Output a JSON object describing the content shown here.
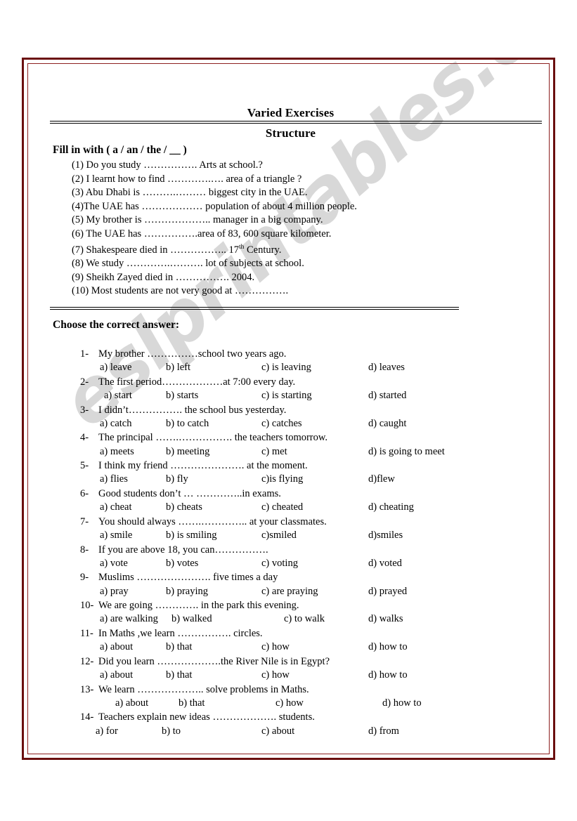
{
  "document": {
    "title": "Varied Exercises",
    "subtitle": "Structure"
  },
  "watermark": {
    "text": "eslprintables.com",
    "color": "#5a5a5a"
  },
  "frame": {
    "outer_color": "#6b0f0f",
    "inner_color": "#8d2020"
  },
  "section_fill": {
    "heading": "Fill in with (  a  /  an  / the /  __  )",
    "items": [
      "(1) Do you study ……………. Arts at school.?",
      "(2) I learnt how to find ………….…. area of a triangle ?",
      "(3) Abu Dhabi is ……….……… biggest city in the UAE.",
      "(4)The UAE has ……………… population of about  4 million people.",
      "(5) My brother is ……………….. manager in a big company.",
      "(6) The UAE has …………….area of 83, 600 square kilometer.",
      "(7) Shakespeare died in …………….. 17",
      "(8) We study ………….………. lot of  subjects at school.",
      "(9) Sheikh Zayed died in ……………. 2004.",
      "(10) Most students are not very good at ……………."
    ],
    "item7_superscript": "th",
    "item7_tail": " Century."
  },
  "section_choose": {
    "heading": "Choose the correct answer:",
    "questions": [
      {
        "number": "1-",
        "stem": "My brother ……………school two years ago.",
        "options": [
          "a) leave",
          "b) left",
          "c) is leaving",
          "d) leaves"
        ]
      },
      {
        "number": "2-",
        "stem": "The first period………………at 7:00 every day.",
        "options": [
          "a) start",
          "b) starts",
          "c) is starting",
          "d) started"
        ]
      },
      {
        "number": "3-",
        "stem": "I didn’t……………. the school bus yesterday.",
        "options": [
          "a) catch",
          "b) to catch",
          "c) catches",
          "d) caught"
        ]
      },
      {
        "number": "4-",
        "stem": "The principal …….……………. the teachers tomorrow.",
        "options": [
          "a) meets",
          "b) meeting",
          "c) met",
          "d) is going to meet"
        ]
      },
      {
        "number": "5-",
        "stem": "I think my friend …………………. at the moment.",
        "options": [
          "a) flies",
          "b) fly",
          "c)is flying",
          "d)flew"
        ]
      },
      {
        "number": "6-",
        "stem": "Good students don’t … …………..in exams.",
        "options": [
          "a) cheat",
          "b) cheats",
          "c) cheated",
          "d) cheating"
        ]
      },
      {
        "number": "7-",
        "stem": "You should always …….………….. at your classmates.",
        "options": [
          "a) smile",
          "b) is smiling",
          "c)smiled",
          "d)smiles"
        ]
      },
      {
        "number": "8-",
        "stem": "If you are above 18, you can…………….",
        "options": [
          "a) vote",
          "b) votes",
          "c) voting",
          "d) voted"
        ]
      },
      {
        "number": "9-",
        "stem": "Muslims …………………. five times a day",
        "options": [
          "a) pray",
          "b)  praying",
          "c) are praying",
          "d) prayed"
        ]
      },
      {
        "number": "10-",
        "stem": "We are going …………. in the park this evening.",
        "options": [
          "a) are walking",
          "b) walked",
          "c) to walk",
          "d) walks"
        ]
      },
      {
        "number": "11-",
        "stem": "In Maths ,we learn ……………. circles.",
        "options": [
          "a) about",
          "b) that",
          "c) how",
          "d) how to"
        ]
      },
      {
        "number": "12-",
        "stem": "Did you learn ……………….the River Nile is in Egypt?",
        "options": [
          "a) about",
          "b) that",
          "c) how",
          "d) how to"
        ]
      },
      {
        "number": "13-",
        "stem": "We learn ……………….. solve problems in Maths.",
        "options": [
          "a) about",
          "b) that",
          "c) how",
          "d) how to"
        ]
      },
      {
        "number": "14-",
        "stem": "Teachers explain new ideas ………………. students.",
        "options": [
          "a) for",
          "b) to",
          "c) about",
          "d) from"
        ]
      }
    ]
  }
}
